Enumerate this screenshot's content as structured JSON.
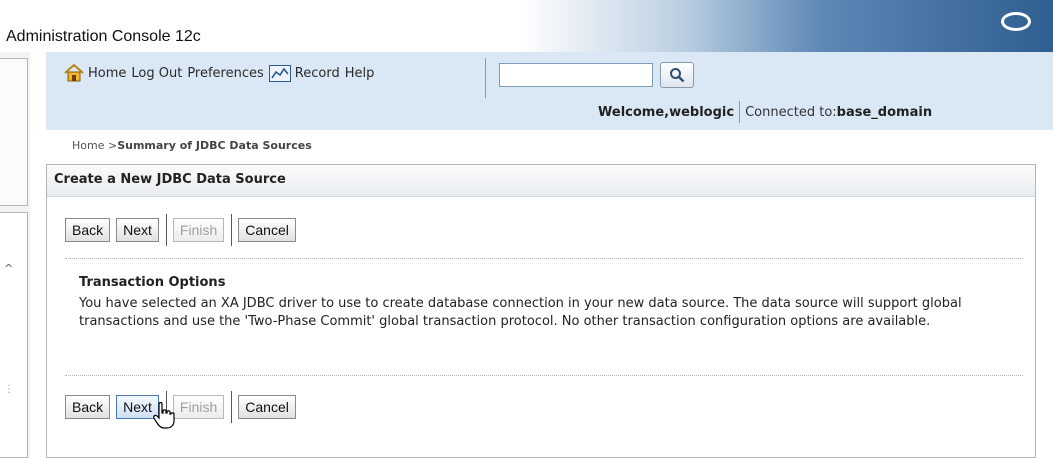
{
  "app": {
    "title": "Administration Console 12c"
  },
  "header": {
    "links": {
      "home": "Home",
      "logout": "Log Out",
      "preferences": "Preferences",
      "record": "Record",
      "help": "Help"
    },
    "search": {
      "value": "",
      "placeholder": ""
    },
    "welcome_prefix": "Welcome, ",
    "user": "weblogic",
    "connected_prefix": "Connected to: ",
    "domain": "base_domain"
  },
  "breadcrumb": {
    "home": "Home",
    "separator": " >",
    "current": "Summary of JDBC Data Sources"
  },
  "panel": {
    "title": "Create a New JDBC Data Source",
    "buttons": {
      "back": "Back",
      "next": "Next",
      "finish": "Finish",
      "cancel": "Cancel"
    },
    "section_title": "Transaction Options",
    "section_text": "You have selected an XA JDBC driver to use to create database connection in your new data source. The data source will support global transactions and use the 'Two-Phase Commit' global transaction protocol. No other transaction configuration options are available."
  },
  "icons": [
    "home-icon",
    "record-icon",
    "search-icon",
    "oracle-logo-icon",
    "mouse-cursor-icon"
  ],
  "colors": {
    "header_bar": "#dae7f5",
    "title_gradient_end": "#2f5e90",
    "panel_border": "#b5b5b5"
  }
}
